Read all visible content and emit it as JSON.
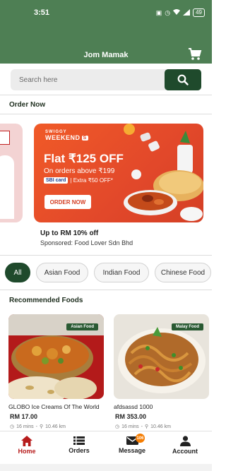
{
  "status_bar": {
    "time": "3:51",
    "battery": "49"
  },
  "app_bar": {
    "title": "Jom Mamak"
  },
  "search": {
    "placeholder": "Search here"
  },
  "order_now": {
    "title": "Order Now",
    "banner": {
      "brand_top": "SWIGGY",
      "brand_bottom": "WEEKEND",
      "brand_mark": "S",
      "headline": "Flat ₹125 OFF",
      "subline": "On orders above ₹199",
      "card_name": "SBI card",
      "extra": "| Extra ₹50 OFF*",
      "cta": "ORDER NOW"
    },
    "promo_title": "Up to RM 10% off",
    "promo_sponsor": "Sponsored: Food Lover Sdn Bhd"
  },
  "categories": [
    "All",
    "Asian Food",
    "Indian Food",
    "Chinese Food"
  ],
  "recommended": {
    "title": "Recommended Foods",
    "items": [
      {
        "tag": "Asian Food",
        "name": "GLOBO Ice Creams Of The World",
        "price": "RM 17.00",
        "time": "16 mins",
        "distance": "10.46 km"
      },
      {
        "tag": "Malay Food",
        "name": "afdsassd 1000",
        "price": "RM 353.00",
        "time": "16 mins",
        "distance": "10.46 km"
      }
    ]
  },
  "bottom_nav": [
    {
      "label": "Home",
      "icon": "home-icon"
    },
    {
      "label": "Orders",
      "icon": "list-icon"
    },
    {
      "label": "Message",
      "icon": "mail-icon",
      "badge": "106"
    },
    {
      "label": "Account",
      "icon": "person-icon"
    }
  ],
  "colors": {
    "primary": "#4e7f54",
    "dark_green": "#1f4a2c",
    "banner_orange": "#e2482a",
    "active_nav": "#b71c1c"
  }
}
